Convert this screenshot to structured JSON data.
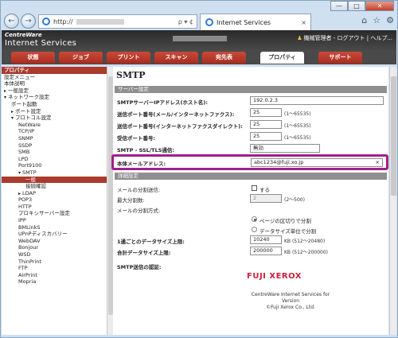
{
  "browser": {
    "address_url": "http://",
    "tab_title": "Internet Services",
    "controls": {
      "minimize": "—",
      "maximize": "□",
      "close": "✕"
    },
    "nav_back": "←",
    "nav_forward": "→",
    "addr_controls": "ρ ▾ ¢",
    "tab_close": "×",
    "toolbar_icons": [
      "home-icon",
      "star-icon",
      "gear-icon"
    ]
  },
  "header": {
    "brand_line1": "CentreWare",
    "brand_line2": "Internet Services",
    "user_text": "機械管理者 - ログアウト | ヘルプ..."
  },
  "main_tabs": [
    "状態",
    "ジョブ",
    "プリント",
    "スキャン",
    "宛先表",
    "プロパティ",
    "サポート"
  ],
  "active_tab": "プロパティ",
  "sidebar": {
    "header": "プロパティ",
    "items": [
      {
        "label": "設定メニュー",
        "indent": 0,
        "arrow": ""
      },
      {
        "label": "本体説明",
        "indent": 0,
        "arrow": ""
      },
      {
        "label": "一般設定",
        "indent": 0,
        "arrow": "▸"
      },
      {
        "label": "ネットワーク設定",
        "indent": 0,
        "arrow": "▾"
      },
      {
        "label": "ポート起動",
        "indent": 1,
        "arrow": ""
      },
      {
        "label": "ポート設定",
        "indent": 1,
        "arrow": "▸"
      },
      {
        "label": "プロトコル設定",
        "indent": 1,
        "arrow": "▾"
      },
      {
        "label": "NetWare",
        "indent": 2,
        "arrow": ""
      },
      {
        "label": "TCP/IP",
        "indent": 2,
        "arrow": ""
      },
      {
        "label": "SNMP",
        "indent": 2,
        "arrow": ""
      },
      {
        "label": "SSDP",
        "indent": 2,
        "arrow": ""
      },
      {
        "label": "SMB",
        "indent": 2,
        "arrow": ""
      },
      {
        "label": "LPD",
        "indent": 2,
        "arrow": ""
      },
      {
        "label": "Port9100",
        "indent": 2,
        "arrow": ""
      },
      {
        "label": "SMTP",
        "indent": 2,
        "arrow": "▾"
      },
      {
        "label": "一般",
        "indent": 3,
        "arrow": "",
        "selected": true
      },
      {
        "label": "接続確認",
        "indent": 3,
        "arrow": ""
      },
      {
        "label": "LDAP",
        "indent": 2,
        "arrow": "▸"
      },
      {
        "label": "POP3",
        "indent": 2,
        "arrow": ""
      },
      {
        "label": "HTTP",
        "indent": 2,
        "arrow": ""
      },
      {
        "label": "プロキシサーバー設定",
        "indent": 2,
        "arrow": ""
      },
      {
        "label": "IPP",
        "indent": 2,
        "arrow": ""
      },
      {
        "label": "BMLinkS",
        "indent": 2,
        "arrow": ""
      },
      {
        "label": "UPnPディスカバリー",
        "indent": 2,
        "arrow": ""
      },
      {
        "label": "WebDAV",
        "indent": 2,
        "arrow": ""
      },
      {
        "label": "Bonjour",
        "indent": 2,
        "arrow": ""
      },
      {
        "label": "WSD",
        "indent": 2,
        "arrow": ""
      },
      {
        "label": "ThinPrint",
        "indent": 2,
        "arrow": ""
      },
      {
        "label": "FTP",
        "indent": 2,
        "arrow": ""
      },
      {
        "label": "AirPrint",
        "indent": 2,
        "arrow": ""
      },
      {
        "label": "Mopria",
        "indent": 2,
        "arrow": ""
      }
    ]
  },
  "content": {
    "title": "SMTP",
    "server_section": "サーバー設定",
    "fields": {
      "server_address": {
        "label": "SMTPサーバーIPアドレス(ホスト名):",
        "value": "192.0.2.3"
      },
      "port_internet_fax": {
        "label": "送信ポート番号(メール/インターネットファクス):",
        "value": "25",
        "hint": "(1〜65535)"
      },
      "port_direct_fax": {
        "label": "送信ポート番号(インターネットファクスダイレクト):",
        "value": "25",
        "hint": "(1〜65535)"
      },
      "port_receive": {
        "label": "受信ポート番号:",
        "value": "25",
        "hint": "(1〜65535)"
      },
      "ssl_tls": {
        "label": "SMTP - SSL/TLS通信:",
        "value": "無効"
      },
      "device_email": {
        "label": "本体メールアドレス:",
        "value": "abc1234@fuji.xo.jp",
        "clear": "×"
      }
    },
    "detail_section": "詳細設定",
    "split": {
      "label": "メールの分割送信:",
      "checkbox_label": "する",
      "max_split_label": "最大分割数:",
      "max_split_value": "2",
      "max_split_hint": "(2〜500)",
      "method_label": "メールの分割方式:",
      "option_page": "ページの区切りで分割",
      "option_data": "データサイズ単位で分割"
    },
    "size": {
      "per_mail_label": "1通ごとのデータサイズ上限:",
      "per_mail_value": "10240",
      "per_mail_hint": "KB (512〜20480)",
      "total_label": "合計データサイズ上限:",
      "total_value": "200000",
      "total_hint": "KB (512〜200000)"
    },
    "auth_label": "SMTP送信の認証:"
  },
  "footer": {
    "logo": "FUJI XEROX",
    "line1": "CentreWare Internet Services for",
    "line2": "Version",
    "line3": "©Fuji Xerox Co., Ltd."
  }
}
